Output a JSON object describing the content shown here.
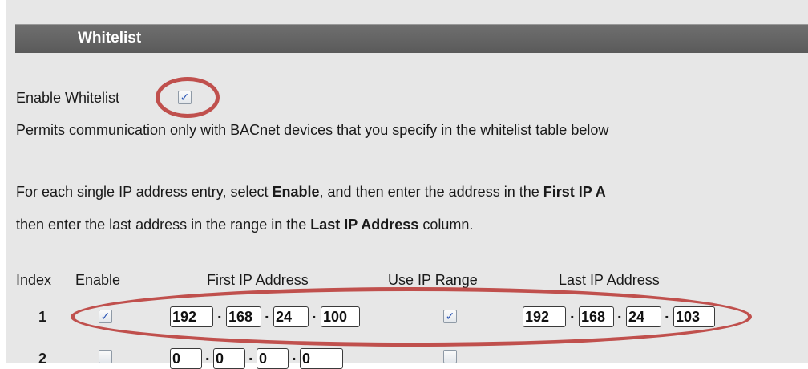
{
  "header": {
    "title": "Whitelist"
  },
  "enable_whitelist": {
    "label": "Enable Whitelist",
    "checked": true,
    "check_glyph": "✓"
  },
  "desc1": "Permits communication only with BACnet devices that you specify in the whitelist table below",
  "desc2": {
    "p1": "For each single IP address entry, select ",
    "b1": "Enable",
    "p2": ", and then enter the address in the ",
    "b2": "First IP A"
  },
  "desc3": {
    "p1": "then enter the last address in the range in the ",
    "b1": "Last IP Address",
    "p2": " column."
  },
  "table": {
    "columns": {
      "index": "Index",
      "enable": "Enable",
      "first_ip": "First IP Address",
      "use_range": "Use IP Range",
      "last_ip": "Last IP Address"
    },
    "rows": [
      {
        "index": "1",
        "enable": "✓",
        "first": [
          "192",
          "168",
          "24",
          "100"
        ],
        "use_range": "✓",
        "last": [
          "192",
          "168",
          "24",
          "103"
        ]
      },
      {
        "index": "2",
        "enable": "",
        "first": [
          "0",
          "0",
          "0",
          "0"
        ],
        "use_range": "",
        "last": []
      }
    ],
    "separator": "."
  },
  "highlight_color": "#c0504d"
}
